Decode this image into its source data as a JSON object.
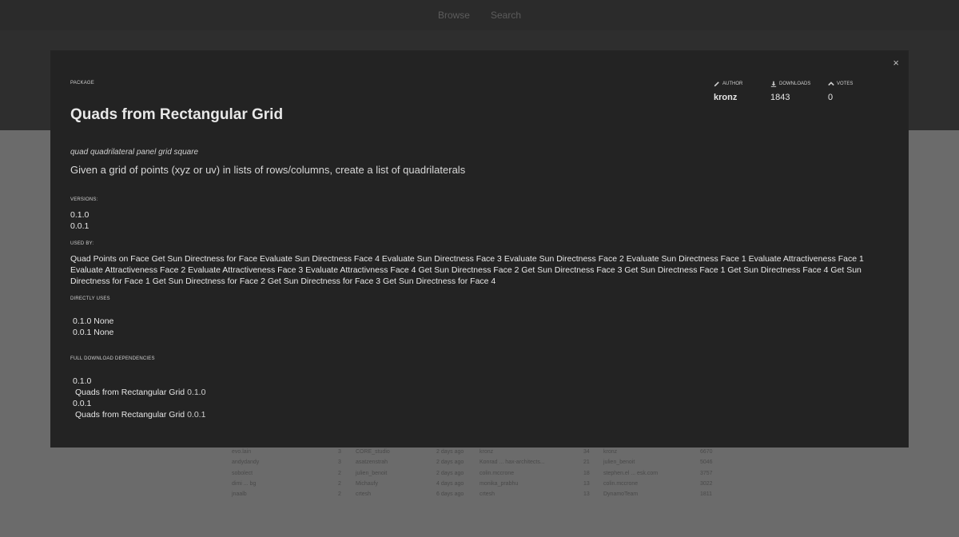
{
  "nav": {
    "browse": "Browse",
    "search": "Search"
  },
  "modal": {
    "close_icon": "×",
    "package_label": "PACKAGE",
    "title": "Quads from Rectangular Grid",
    "author_label": "AUTHOR",
    "author": "kronz",
    "downloads_label": "DOWNLOADS",
    "downloads": "1843",
    "votes_label": "VOTES",
    "votes": "0",
    "keywords": "quad quadrilateral panel grid square",
    "description": "Given a grid of points (xyz or uv) in lists of rows/columns, create a list of quadrilaterals",
    "versions_label": "VERSIONS:",
    "versions": [
      "0.1.0",
      "0.0.1"
    ],
    "used_by_label": "USED BY:",
    "used_by": [
      "Quad Points on Face",
      "Get Sun Directness for Face",
      "Evaluate Sun Directness Face 4",
      "Evaluate Sun Directness Face 3",
      "Evaluate Sun Directness Face 2",
      "Evaluate Sun Directness Face 1",
      "Evaluate Attractiveness Face 1",
      "Evaluate Attractiveness Face 2",
      "Evaluate Attractiveness Face 3",
      "Evaluate Attractivness Face 4",
      "Get Sun Directness Face 2",
      "Get Sun Directness Face 3",
      "Get Sun Directness Face 1",
      "Get Sun Directness Face 4",
      "Get Sun Directness for Face 1",
      "Get Sun Directness for Face 2",
      "Get Sun Directness for Face 3",
      "Get Sun Directness for Face 4"
    ],
    "directly_uses_label": "DIRECTLY USES",
    "directly_uses": [
      {
        "version": "0.1.0",
        "value": "None"
      },
      {
        "version": "0.0.1",
        "value": "None"
      }
    ],
    "full_deps_label": "FULL DOWNLOAD DEPENDENCIES",
    "full_deps": [
      {
        "version": "0.1.0",
        "name": "Quads from Rectangular Grid",
        "dep_version": "0.1.0"
      },
      {
        "version": "0.0.1",
        "name": "Quads from Rectangular Grid",
        "dep_version": "0.0.1"
      }
    ],
    "icons": {
      "author": "pencil-icon",
      "downloads": "download-icon",
      "votes": "chevron-up-icon"
    }
  },
  "background_table": {
    "rows": [
      [
        "evo.lain",
        "3",
        "CORE_studio",
        "2 days ago",
        "kronz",
        "34",
        "kronz",
        "6670"
      ],
      [
        "andydandy",
        "3",
        "asatzenstrah",
        "2 days ago",
        "Konrad ... hax-architects...",
        "21",
        "julien_benoit",
        "5046"
      ],
      [
        "sobolect",
        "2",
        "julien_benoit",
        "2 days ago",
        "colin.mccrone",
        "18",
        "stephen.el ... esk.com",
        "3757"
      ],
      [
        "dimi ... bg",
        "2",
        "Michaufy",
        "4 days ago",
        "monika_prabhu",
        "13",
        "colin.mccrone",
        "3022"
      ],
      [
        "jnaalb",
        "2",
        "crtesh",
        "6 days ago",
        "crtesh",
        "13",
        "DynamoTeam",
        "1811"
      ]
    ]
  }
}
